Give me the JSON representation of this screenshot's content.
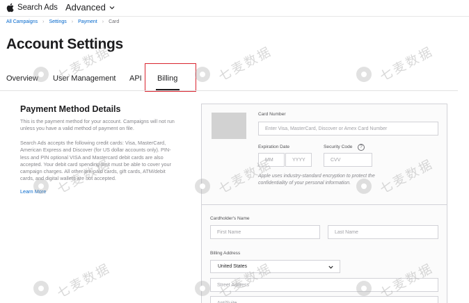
{
  "app": {
    "brand": "Search Ads",
    "workspace": "Advanced"
  },
  "breadcrumb": [
    {
      "label": "All Campaigns"
    },
    {
      "label": "Settings"
    },
    {
      "label": "Payment"
    },
    {
      "label": "Card"
    }
  ],
  "page": {
    "title": "Account Settings"
  },
  "tabs": [
    {
      "label": "Overview"
    },
    {
      "label": "User Management"
    },
    {
      "label": "API"
    },
    {
      "label": "Billing",
      "selected": true
    }
  ],
  "section": {
    "title": "Payment Method Details",
    "para1": "This is the payment method for your account. Campaigns will not run unless you have a valid method of payment on file.",
    "para2": "Search Ads accepts the following credit cards: Visa, MasterCard, American Express and Discover (for US dollar accounts only). PIN-less and PIN optional VISA and Mastercard debit cards are also accepted. Your debit card spending limit must be able to cover your campaign charges. All other pre-paid cards, gift cards, ATM/debit cards, and digital wallets are not accepted.",
    "learn_more": "Learn More"
  },
  "form": {
    "card_number_label": "Card Number",
    "card_number_placeholder": "Enter Visa, MasterCard, Discover or Amex Card Number",
    "expiration_label": "Expiration Date",
    "mm_placeholder": "MM",
    "yyyy_placeholder": "YYYY",
    "security_label": "Security Code",
    "help_glyph": "?",
    "cvv_placeholder": "CVV",
    "encryption_note": "Apple uses industry-standard encryption to protect the confidentiality of your personal information.",
    "cardholder_label": "Cardholder's Name",
    "first_name_placeholder": "First Name",
    "last_name_placeholder": "Last Name",
    "billing_address_label": "Billing Address",
    "country_value": "United States",
    "street_placeholder": "Street Address",
    "apt_placeholder": "Apt/Suite"
  },
  "watermark": {
    "text": "七麦数据"
  },
  "colors": {
    "link": "#0066cc",
    "highlight_box": "#d9232e",
    "text": "#1d1d1f",
    "muted": "#86868b"
  }
}
